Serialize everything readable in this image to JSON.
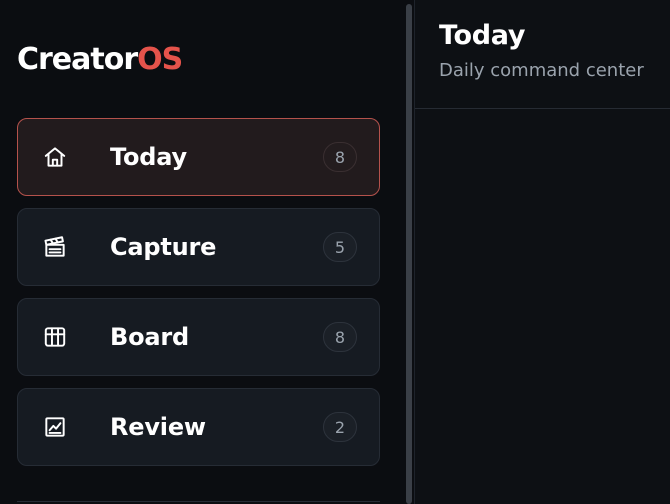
{
  "brand": {
    "name_main": "Creator",
    "name_accent": "OS",
    "accent_color": "#e5534b"
  },
  "sidebar": {
    "items": [
      {
        "label": "Today",
        "count": "8",
        "icon": "home-icon",
        "active": true
      },
      {
        "label": "Capture",
        "count": "5",
        "icon": "clapperboard-icon",
        "active": false
      },
      {
        "label": "Board",
        "count": "8",
        "icon": "grid-board-icon",
        "active": false
      },
      {
        "label": "Review",
        "count": "2",
        "icon": "chart-icon",
        "active": false
      }
    ]
  },
  "main": {
    "title": "Today",
    "subtitle": "Daily command center"
  },
  "colors": {
    "background": "#0c0e12",
    "card": "#161b22",
    "active_card": "#221b1d",
    "active_border": "#b5524c",
    "muted_text": "#9aa3ad"
  }
}
